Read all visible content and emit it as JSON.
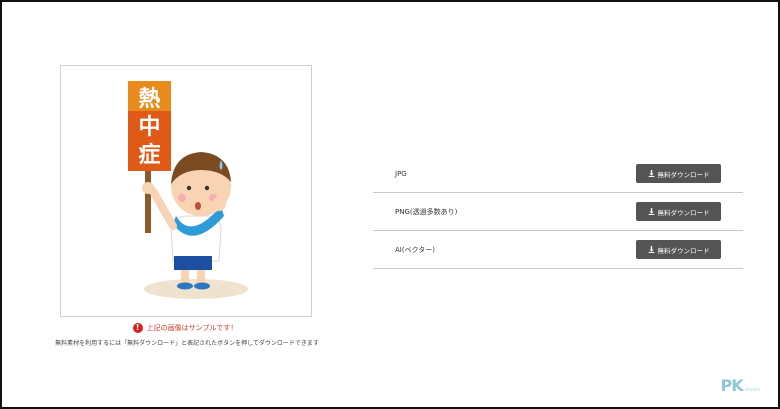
{
  "preview": {
    "sign_text": [
      "熱",
      "中",
      "症"
    ]
  },
  "notice": {
    "icon": "exclamation-icon",
    "text": "上記の画像はサンプルです！"
  },
  "instructions": "無料素材を利用するには「無料ダウンロード」と表記されたボタンを押してダウンロードできます",
  "downloads": {
    "items": [
      {
        "label": "JPG",
        "button": "無料ダウンロード"
      },
      {
        "label": "PNG(透過多数あり)",
        "button": "無料ダウンロード"
      },
      {
        "label": "AI(ベクター)",
        "button": "無料ダウンロード"
      }
    ]
  },
  "watermark": {
    "logo": "PK",
    "subtext": "studio"
  },
  "colors": {
    "button_bg": "#545454",
    "notice_red": "#d9372c",
    "divider": "#c9c9c9"
  }
}
